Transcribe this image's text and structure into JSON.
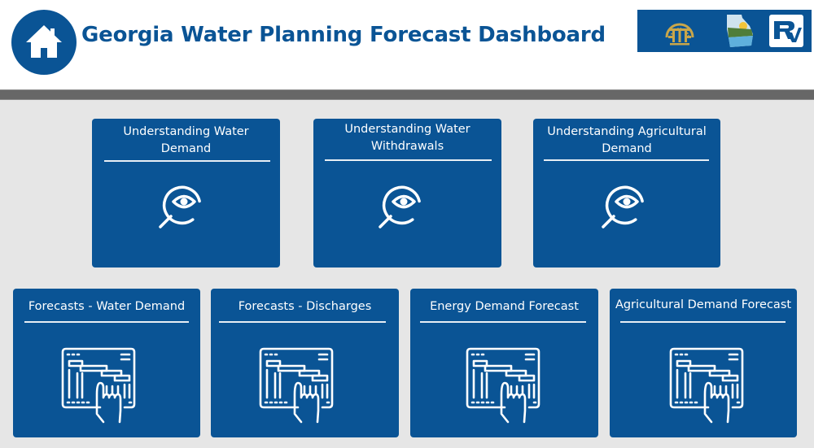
{
  "header": {
    "title": "Georgia Water Planning Forecast Dashboard",
    "home_icon": "home-icon",
    "logos": [
      "georgia-state-seal-logo",
      "georgia-map-logo",
      "rv-logo"
    ]
  },
  "colors": {
    "brand_blue": "#0a5495",
    "background": "#e6e6e6",
    "divider": "#676767"
  },
  "understanding_cards": [
    {
      "label": "Understanding Water Demand",
      "line1": "Understanding Water",
      "line2": "Demand",
      "icon": "magnifier-eye-icon"
    },
    {
      "label": "Understanding Water Withdrawals",
      "line1": "Understanding Water",
      "line2": "Withdrawals",
      "icon": "magnifier-eye-icon"
    },
    {
      "label": "Understanding Agricultural Demand",
      "line1": "Understanding Agricultural",
      "line2": "Demand",
      "icon": "magnifier-eye-icon"
    }
  ],
  "forecast_cards": [
    {
      "label": "Forecasts - Water Demand",
      "icon": "gantt-touch-icon"
    },
    {
      "label": "Forecasts - Discharges",
      "icon": "gantt-touch-icon"
    },
    {
      "label": "Energy Demand Forecast",
      "icon": "gantt-touch-icon"
    },
    {
      "label": "Agricultural Demand Forecast",
      "icon": "gantt-touch-icon"
    }
  ]
}
